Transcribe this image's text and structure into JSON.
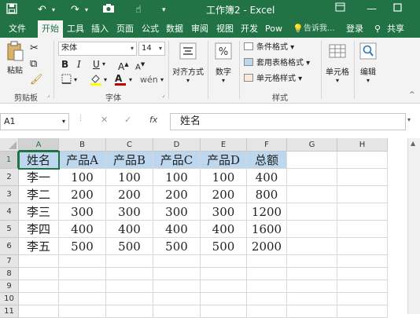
{
  "title_bar": {
    "title": "工作簿2 - Excel",
    "icons": [
      "save-icon",
      "undo-icon",
      "redo-icon",
      "camera-icon",
      "touch-mode-icon",
      "customize-icon"
    ],
    "window_buttons": [
      "restore-ribbon-icon",
      "minimize-icon",
      "maximize-icon",
      "close-icon"
    ]
  },
  "ribbon_tabs": [
    {
      "label": "文件",
      "active": false
    },
    {
      "label": "开始",
      "active": true
    },
    {
      "label": "工具",
      "active": false
    },
    {
      "label": "插入",
      "active": false
    },
    {
      "label": "页面",
      "active": false
    },
    {
      "label": "公式",
      "active": false
    },
    {
      "label": "数据",
      "active": false
    },
    {
      "label": "审阅",
      "active": false
    },
    {
      "label": "视图",
      "active": false
    },
    {
      "label": "开发",
      "active": false
    },
    {
      "label": "Pow",
      "active": false
    }
  ],
  "tell_me": "告诉我...",
  "login": "登录",
  "share": "共享",
  "ribbon": {
    "clipboard": {
      "paste": "粘贴",
      "group_label": "剪贴板"
    },
    "font": {
      "font_name": "宋体",
      "font_size": "14",
      "bold": "B",
      "italic": "I",
      "underline": "U",
      "grow_font": "A",
      "shrink_font": "A",
      "font_color_letter": "A",
      "group_label": "字体"
    },
    "alignment": {
      "label": "对齐方式"
    },
    "number": {
      "label": "数字"
    },
    "styles": {
      "conditional_formatting": "条件格式",
      "format_as_table": "套用表格格式",
      "cell_styles": "单元格样式",
      "group_label": "样式"
    },
    "cells": {
      "label": "单元格"
    },
    "editing": {
      "label": "编辑"
    }
  },
  "formula_bar": {
    "name_box": "A1",
    "fx": "fx",
    "content": "姓名"
  },
  "grid": {
    "columns": [
      "A",
      "B",
      "C",
      "D",
      "E",
      "F",
      "G",
      "H"
    ],
    "rows": [
      "1",
      "2",
      "3",
      "4",
      "5",
      "6",
      "7",
      "8",
      "9",
      "10",
      "11"
    ],
    "cells": [
      [
        "姓名",
        "产品A",
        "产品B",
        "产品C",
        "产品D",
        "总额"
      ],
      [
        "李一",
        "100",
        "100",
        "100",
        "100",
        "400"
      ],
      [
        "李二",
        "200",
        "200",
        "200",
        "200",
        "800"
      ],
      [
        "李三",
        "300",
        "300",
        "300",
        "300",
        "1200"
      ],
      [
        "李四",
        "400",
        "400",
        "400",
        "400",
        "1600"
      ],
      [
        "李五",
        "500",
        "500",
        "500",
        "500",
        "2000"
      ]
    ],
    "selected_cell": "A1"
  },
  "colors": {
    "excel_green": "#217346",
    "header_fill": "#bdd7ee",
    "font_color_bar": "#c00000",
    "fill_color_bar": "#ffff00"
  }
}
